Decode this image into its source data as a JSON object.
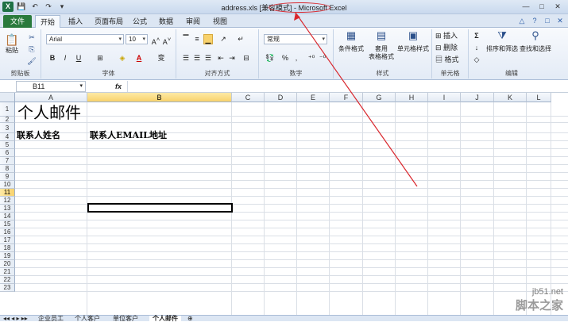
{
  "window": {
    "title": "address.xls  [兼容模式]  -  Microsoft Excel",
    "qat": [
      "X",
      "💾",
      "↶",
      "↷",
      "▾"
    ],
    "controls": [
      "—",
      "□",
      "✕"
    ]
  },
  "ribbon_tabs": [
    "文件",
    "开始",
    "插入",
    "页面布局",
    "公式",
    "数据",
    "审阅",
    "视图"
  ],
  "ribbon": {
    "clipboard": {
      "label": "剪贴板",
      "paste": "粘贴"
    },
    "font": {
      "label": "字体",
      "name": "Arial",
      "size": "10",
      "bold": "B",
      "italic": "I",
      "underline": "U"
    },
    "alignment": {
      "label": "对齐方式"
    },
    "number": {
      "label": "数字",
      "format": "常规",
      "percent": "%",
      "comma": ","
    },
    "styles": {
      "label": "样式",
      "cond": "条件格式",
      "table1": "套用",
      "table2": "表格格式",
      "cell": "单元格样式"
    },
    "cells": {
      "label": "单元格",
      "insert": "插入",
      "delete": "删除",
      "format": "格式"
    },
    "editing": {
      "label": "编辑",
      "sum": "Σ",
      "sort": "排序和筛选",
      "find": "查找和选择"
    }
  },
  "formula_bar": {
    "name_box": "B11",
    "fx": "fx",
    "value": ""
  },
  "columns": [
    "A",
    "B",
    "C",
    "D",
    "E",
    "F",
    "G",
    "H",
    "I",
    "J",
    "K",
    "L"
  ],
  "rows": [
    "1",
    "2",
    "3",
    "4",
    "5",
    "6",
    "7",
    "8",
    "9",
    "10",
    "11",
    "12",
    "13",
    "14",
    "15",
    "16",
    "17",
    "18",
    "19",
    "20",
    "21",
    "22",
    "23"
  ],
  "cells": {
    "A1": "个人邮件",
    "A3": "联系人姓名",
    "B3": "联系人EMAIL地址"
  },
  "selected": {
    "column": "B",
    "row": "11"
  },
  "sheet_tabs": [
    "企业员工",
    "个人客户",
    "单位客户",
    "个人邮件"
  ],
  "active_sheet": "个人邮件",
  "watermark": {
    "site": "jb51.net",
    "brand": "脚本之家"
  },
  "accent_colors": {
    "file_tab": "#2a7a3c",
    "annotation": "#d9262c",
    "selection": "#f8d26c"
  }
}
